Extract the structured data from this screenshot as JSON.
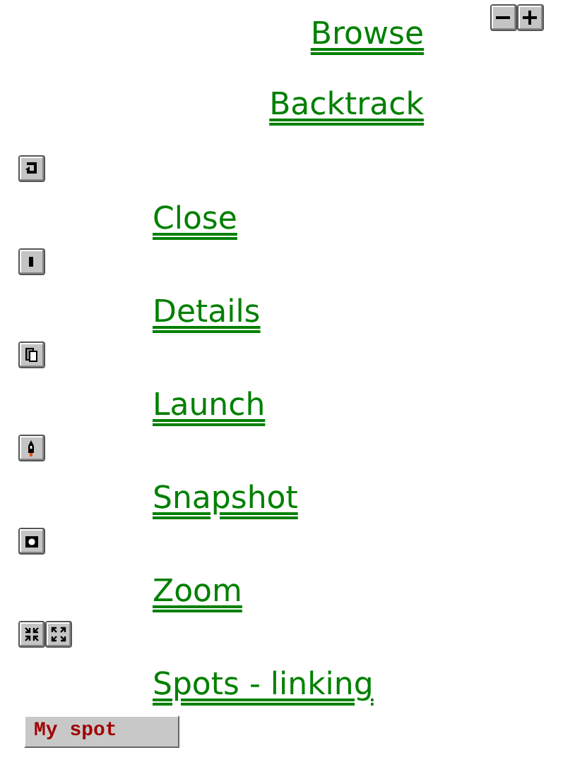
{
  "header_links": [
    {
      "label": "Browse"
    },
    {
      "label": "Backtrack"
    }
  ],
  "zoom_controls": [
    {
      "kind": "minus"
    },
    {
      "kind": "plus"
    }
  ],
  "sections": [
    {
      "icons": [
        {
          "kind": "return"
        }
      ],
      "link": "Close"
    },
    {
      "icons": [
        {
          "kind": "stop"
        }
      ],
      "link": "Details"
    },
    {
      "icons": [
        {
          "kind": "pages"
        }
      ],
      "link": "Launch"
    },
    {
      "icons": [
        {
          "kind": "rocket"
        }
      ],
      "link": "Snapshot"
    },
    {
      "icons": [
        {
          "kind": "camera"
        }
      ],
      "link": "Zoom"
    },
    {
      "icons": [
        {
          "kind": "collapse"
        },
        {
          "kind": "expand"
        }
      ],
      "link": "Spots - linking"
    }
  ],
  "spot_button": "My spot"
}
